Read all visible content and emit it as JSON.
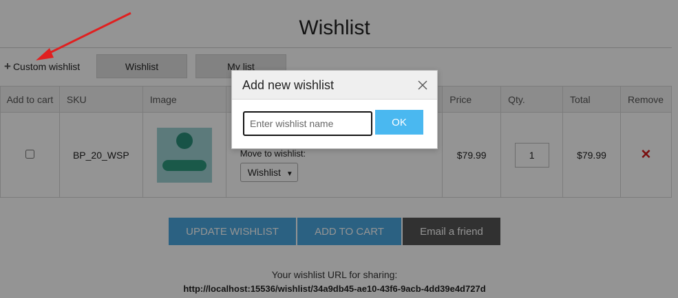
{
  "page": {
    "title": "Wishlist"
  },
  "toolbar": {
    "custom_wishlist_label": "Custom wishlist",
    "tabs": [
      {
        "label": "Wishlist"
      },
      {
        "label": "My list"
      }
    ]
  },
  "table": {
    "headers": [
      "Add to cart",
      "SKU",
      "Image",
      "",
      "Price",
      "Qty.",
      "Total",
      "Remove"
    ],
    "rows": [
      {
        "add_to_cart": false,
        "sku": "BP_20_WSP",
        "move_label": "Move to wishlist:",
        "move_select": "Wishlist",
        "price": "$79.99",
        "qty": "1",
        "total": "$79.99",
        "remove_glyph": "✕"
      }
    ]
  },
  "actions": {
    "update_label": "UPDATE WISHLIST",
    "add_to_cart_label": "ADD TO CART",
    "email_label": "Email a friend"
  },
  "share": {
    "label": "Your wishlist URL for sharing:",
    "url": "http://localhost:15536/wishlist/34a9db45-ae10-43f6-9acb-4dd39e4d727d"
  },
  "dialog": {
    "title": "Add new wishlist",
    "input_placeholder": "Enter wishlist name",
    "ok_label": "OK"
  },
  "colors": {
    "accent": "#4aa8e0",
    "dark_button": "#555555",
    "remove": "#d21a1a",
    "annotation_arrow": "#e02020"
  },
  "icons": {
    "plus": "plus-icon",
    "close": "close-icon",
    "remove": "remove-icon"
  }
}
